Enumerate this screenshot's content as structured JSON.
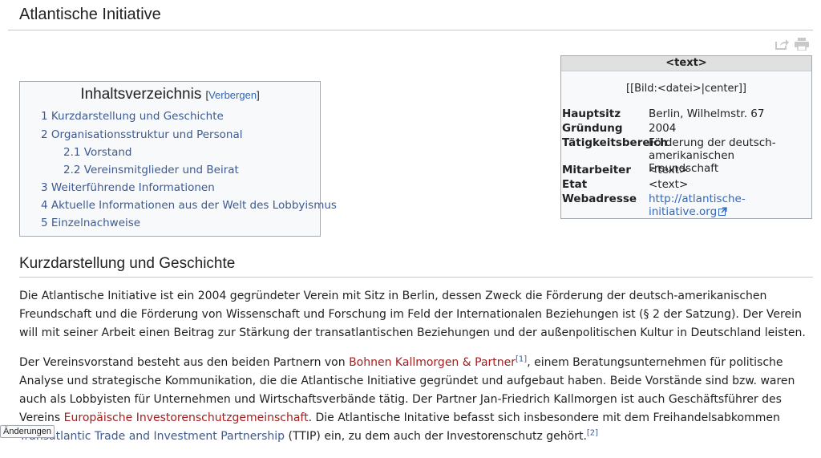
{
  "page": {
    "title": "Atlantische Initiative"
  },
  "tools": {
    "share_icon": "share-icon",
    "print_icon": "print-icon"
  },
  "toc": {
    "title": "Inhaltsverzeichnis",
    "toggle_open": "[",
    "toggle_label": "Verbergen",
    "toggle_close": "]",
    "items": [
      {
        "text": "1 Kurzdarstellung und Geschichte"
      },
      {
        "text": "2 Organisationsstruktur und Personal"
      },
      {
        "text": "2.1 Vorstand"
      },
      {
        "text": "2.2 Vereinsmitglieder und Beirat"
      },
      {
        "text": "3 Weiterführende Informationen"
      },
      {
        "text": "4 Aktuelle Informationen aus der Welt des Lobbyismus"
      },
      {
        "text": "5 Einzelnachweise"
      }
    ]
  },
  "infobox": {
    "header": "<text>",
    "image_placeholder": "[[Bild:<datei>|center]]",
    "rows": [
      {
        "label": "Hauptsitz",
        "value": "Berlin, Wilhelmstr. 67"
      },
      {
        "label": "Gründung",
        "value": "2004"
      },
      {
        "label": "Tätigkeitsbereich",
        "value": "Förderung der deutsch-amerikanischen Freundschaft"
      },
      {
        "label": "Mitarbeiter",
        "value": "<text>"
      },
      {
        "label": "Etat",
        "value": "<text>"
      },
      {
        "label": "Webadresse",
        "value": "http://atlantische-initiative.org"
      }
    ]
  },
  "section": {
    "title": "Kurzdarstellung und Geschichte",
    "para1": "Die Atlantische Initiative ist ein 2004 gegründeter Verein mit Sitz in Berlin, dessen Zweck die Förderung der deutsch-amerikanischen Freundschaft und die Förderung von Wissenschaft und Forschung im Feld der Internationalen Beziehungen ist (§ 2 der Satzung). Der Verein will mit seiner Arbeit einen Beitrag zur Stärkung der transatlantischen Beziehungen und der außenpolitischen Kultur in Deutschland leisten.",
    "para2": {
      "t1": "Der Vereinsvorstand besteht aus den beiden Partnern von ",
      "link1": "Bohnen Kallmorgen & Partner",
      "ref1": "[1]",
      "t2": ", einem Beratungsunternehmen für politische Analyse und strategische Kommunikation, die die Atlantische Initiative gegründet und aufgebaut haben. Beide Vorstände sind bzw. waren auch als Lobbyisten für Unternehmen und Wirtschaftsverbände tätig. Der Partner Jan-Friedrich Kallmorgen ist auch Geschäftsführer des Vereins ",
      "link2": "Europäische Investorenschutzgemeinschaft",
      "t3": ". Die Atlantische Initative befasst sich insbesondere mit dem Freihandelsabkommen ",
      "link3": "Transatlantic Trade and Investment Partnership",
      "t4": " (TTIP) ein, zu dem auch der Investorenschutz gehört.",
      "ref2": "[2]"
    }
  },
  "changes_tab": "Änderungen"
}
